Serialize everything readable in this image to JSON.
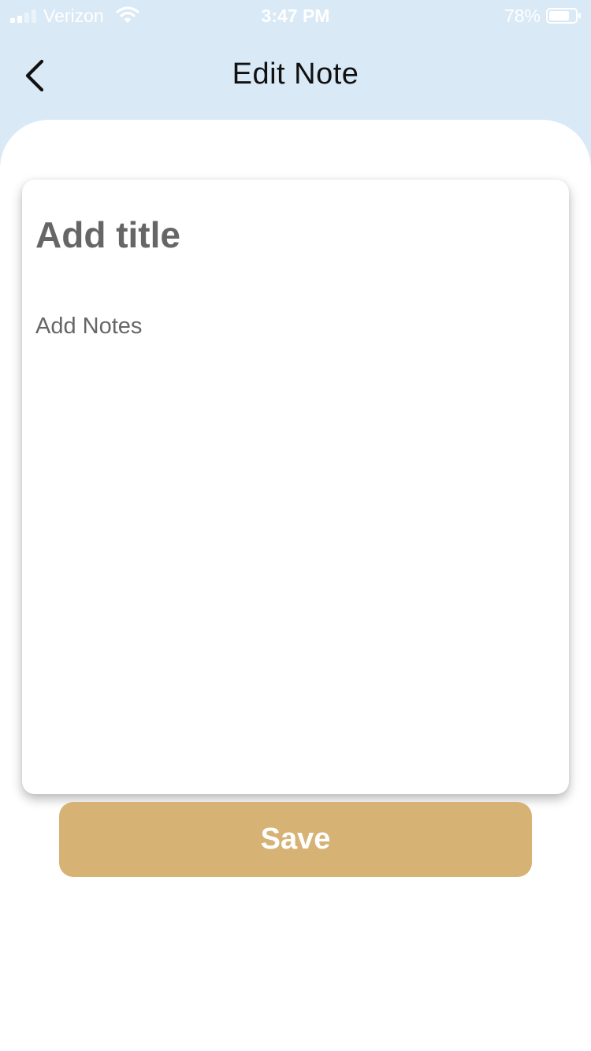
{
  "status_bar": {
    "carrier": "Verizon",
    "time": "3:47 PM",
    "battery_percent": "78%",
    "battery_level": 0.78,
    "signal_icon": "signal-bars-icon",
    "wifi_icon": "wifi-icon",
    "battery_icon": "battery-icon"
  },
  "header": {
    "title": "Edit Note",
    "back_icon": "chevron-left-icon"
  },
  "note": {
    "title_placeholder": "Add title",
    "title_value": "",
    "notes_placeholder": "Add Notes",
    "notes_value": ""
  },
  "actions": {
    "save_label": "Save"
  },
  "colors": {
    "header_background": "#d9e9f5",
    "accent": "#d7b275",
    "placeholder_text": "#666666",
    "title_text": "#111111"
  }
}
